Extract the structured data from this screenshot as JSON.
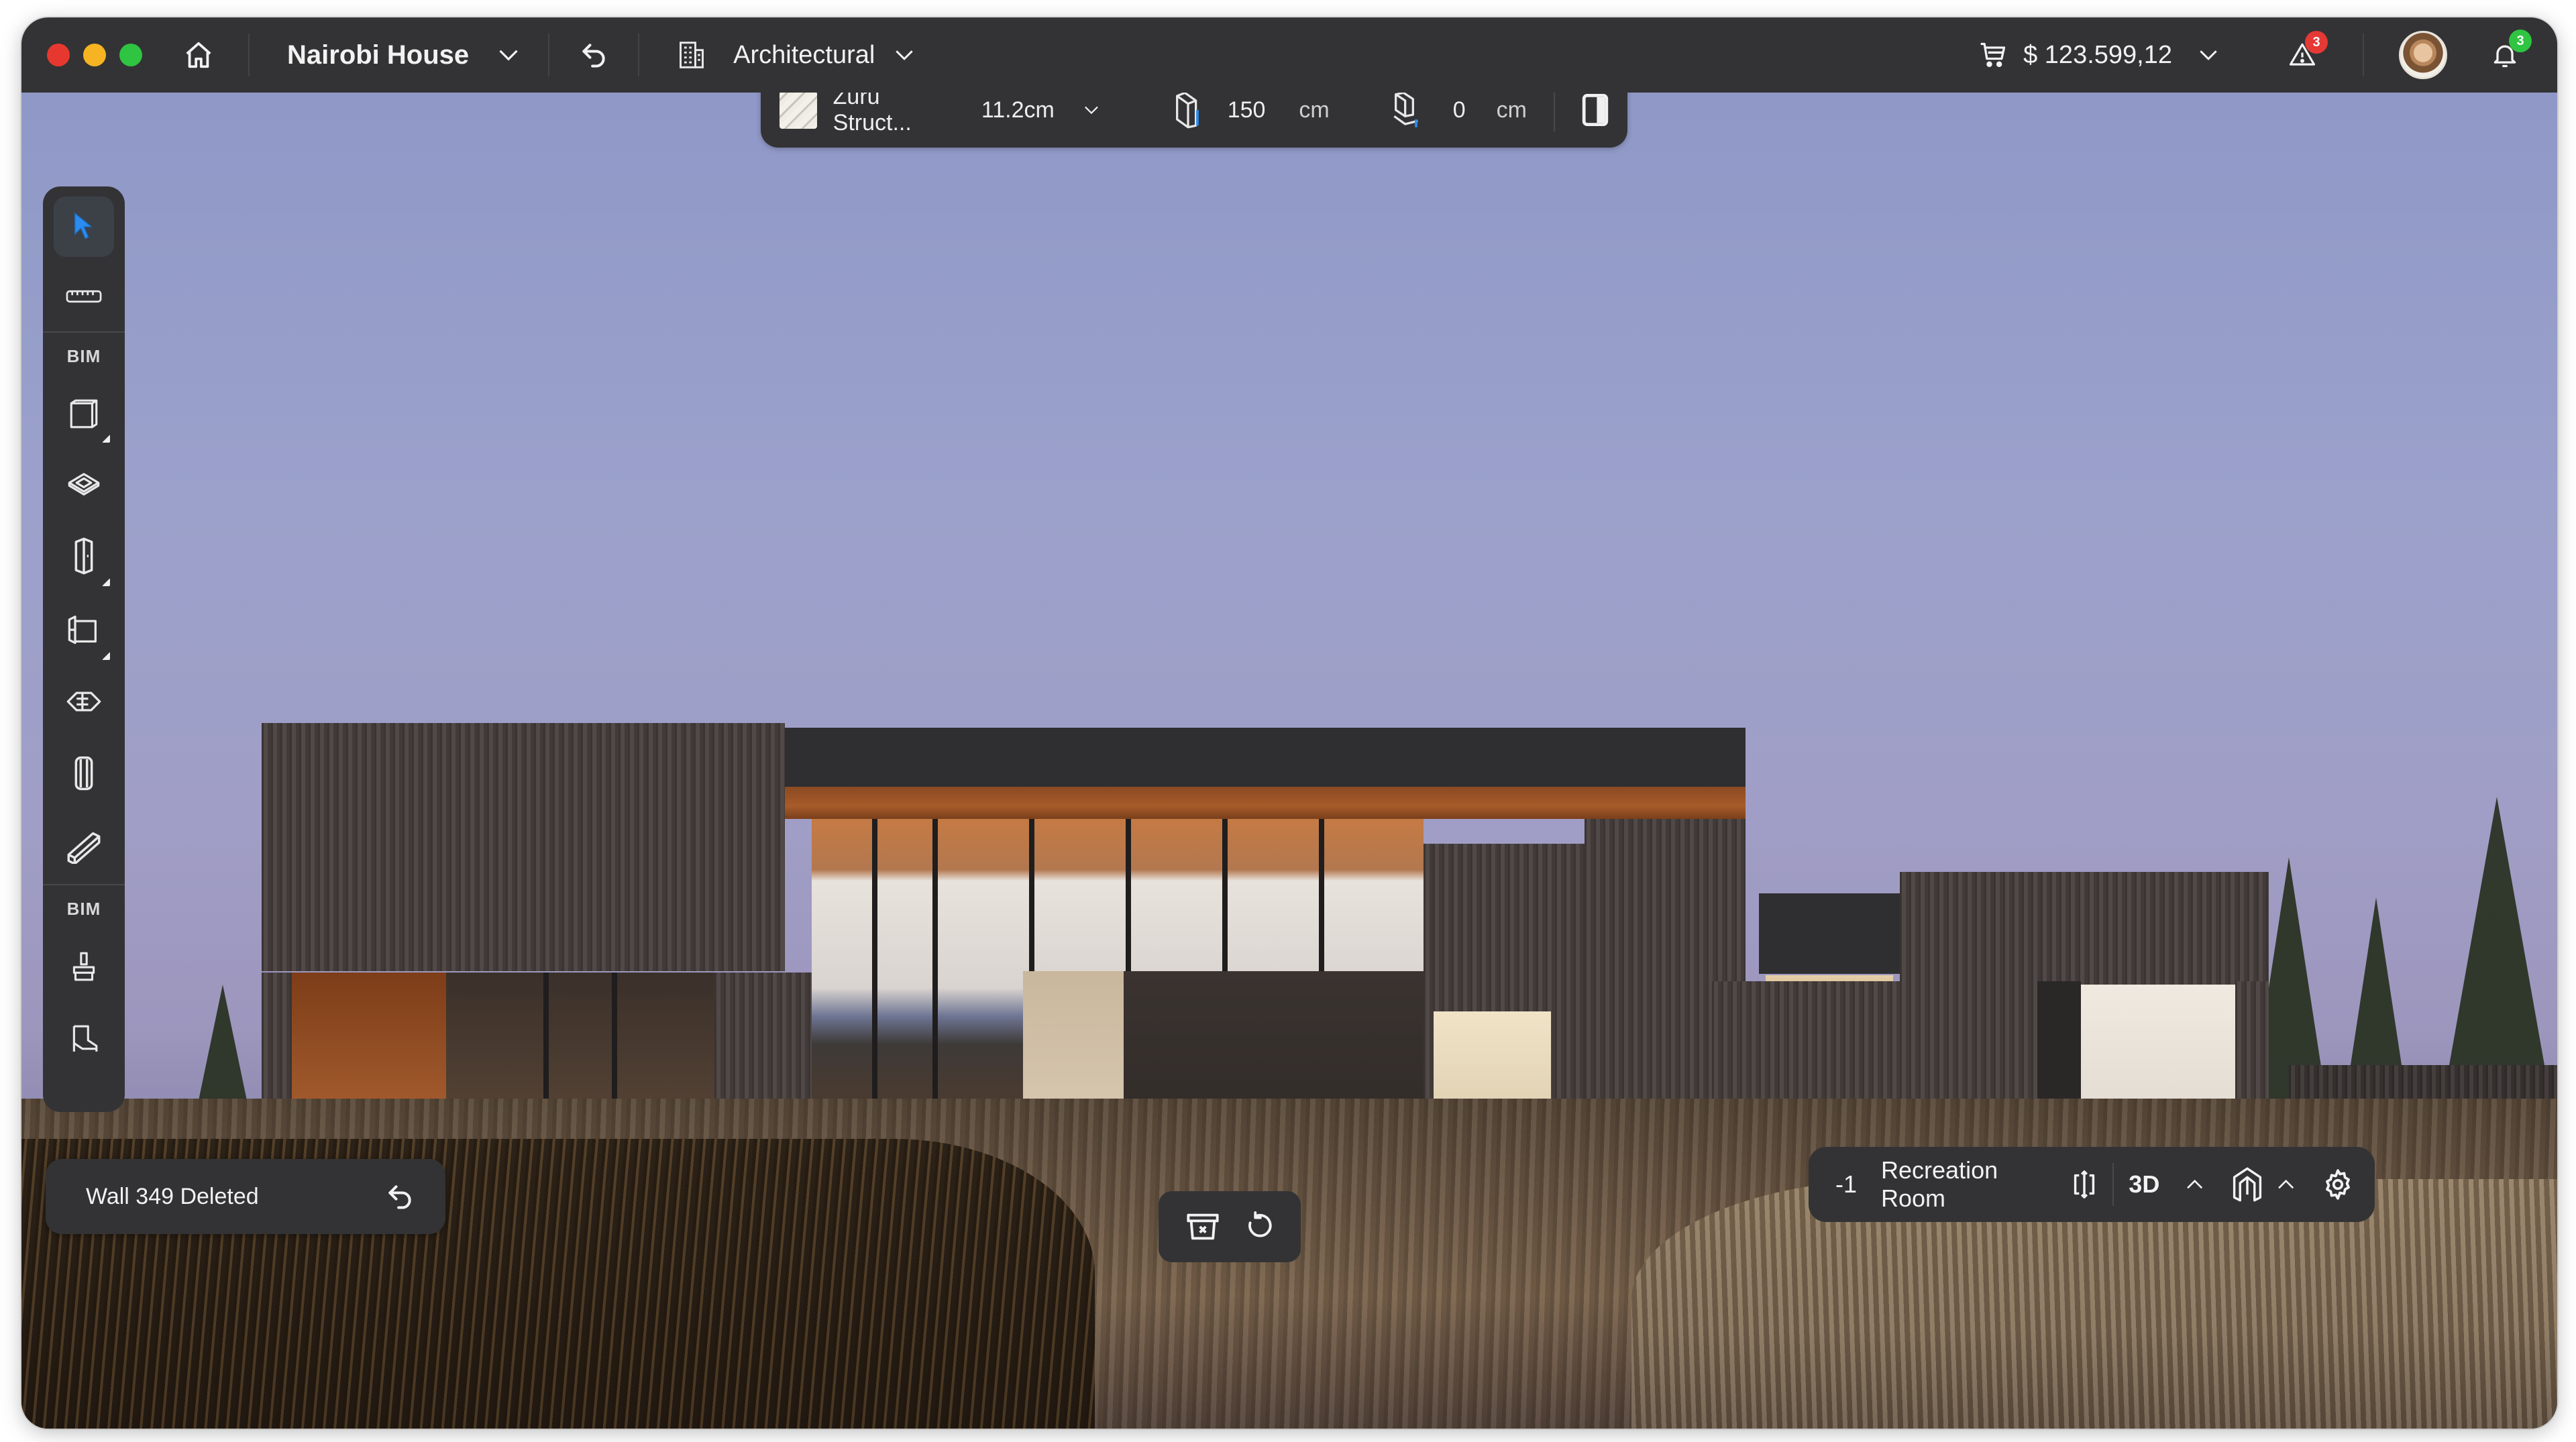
{
  "window": {
    "traffic_lights": [
      "close",
      "minimize",
      "maximize"
    ]
  },
  "titlebar": {
    "home_icon": "home-icon",
    "project_name": "Nairobi House",
    "undo_icon": "undo-icon",
    "discipline_icon": "building-icon",
    "discipline": "Architectural",
    "cart_icon": "cart-icon",
    "total_price": "$ 123.599,12",
    "alerts_count": "3",
    "notifications_count": "3",
    "colors": {
      "alert_badge": "#e53935",
      "notification_badge": "#2fc441"
    }
  },
  "property_bar": {
    "material_name": "Zuru Struct...",
    "thickness": "11.2cm",
    "height_value": "150",
    "height_unit": "cm",
    "offset_value": "0",
    "offset_unit": "cm"
  },
  "toolbar": {
    "section_labels": [
      "BIM",
      "BIM"
    ],
    "tools": [
      {
        "name": "select",
        "icon": "cursor-arrow-icon",
        "active": true
      },
      {
        "name": "measure",
        "icon": "ruler-icon"
      },
      {
        "name": "wall",
        "icon": "wall-box-icon",
        "has_submenu": true
      },
      {
        "name": "slab",
        "icon": "slab-icon"
      },
      {
        "name": "door",
        "icon": "door-icon",
        "has_submenu": true
      },
      {
        "name": "window",
        "icon": "window-icon",
        "has_submenu": true
      },
      {
        "name": "stairs",
        "icon": "stairs-icon"
      },
      {
        "name": "column",
        "icon": "column-icon"
      },
      {
        "name": "beam",
        "icon": "beam-icon"
      },
      {
        "name": "paint",
        "icon": "paint-brush-icon"
      },
      {
        "name": "furniture",
        "icon": "chair-icon"
      }
    ],
    "accent_color": "#2a8cf0"
  },
  "toast": {
    "message": "Wall 349 Deleted",
    "action_icon": "undo-icon"
  },
  "actions_bar": {
    "items": [
      "delete-icon",
      "rotate-icon"
    ]
  },
  "view_bar": {
    "level": "-1",
    "room_name": "Recreation Room",
    "view_mode": "3D"
  }
}
